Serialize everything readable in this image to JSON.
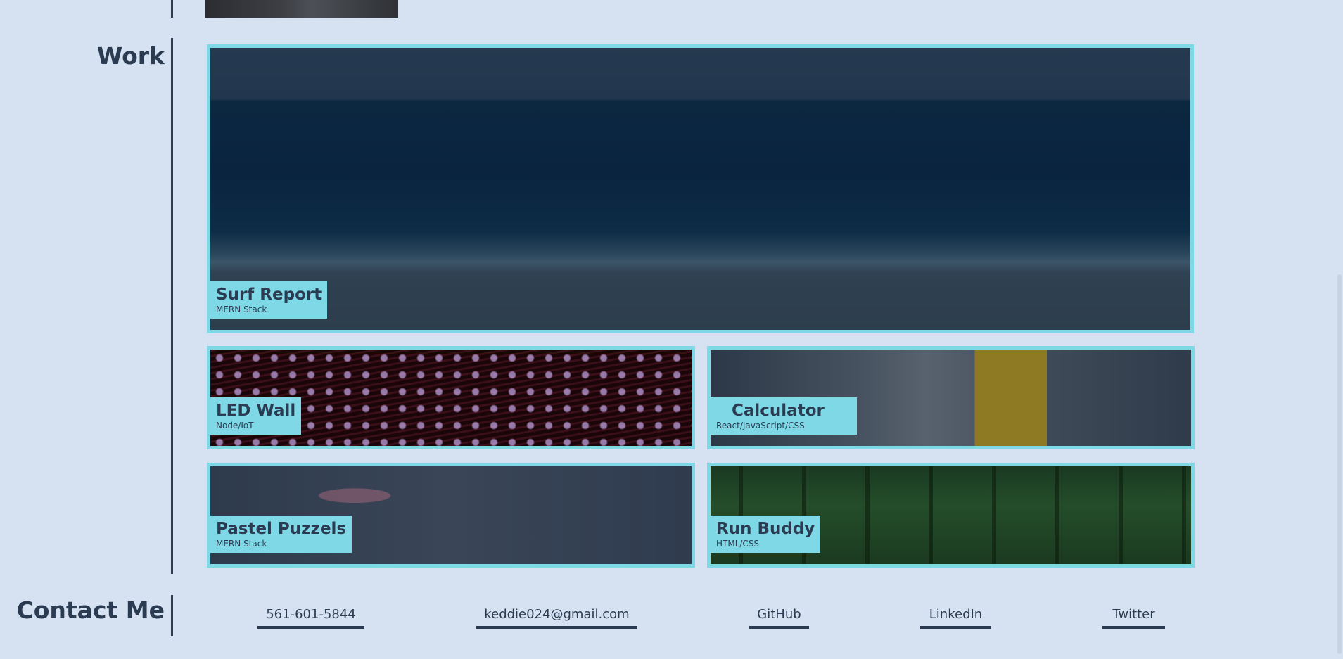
{
  "work": {
    "title": "Work",
    "projects": [
      {
        "name": "Surf Report",
        "tech": "MERN Stack"
      },
      {
        "name": "LED Wall",
        "tech": "Node/IoT"
      },
      {
        "name": "Calculator",
        "tech": "React/JavaScript/CSS"
      },
      {
        "name": "Pastel Puzzels",
        "tech": "MERN Stack"
      },
      {
        "name": "Run Buddy",
        "tech": "HTML/CSS"
      }
    ]
  },
  "contact": {
    "title": "Contact Me",
    "links": [
      {
        "label": "561-601-5844"
      },
      {
        "label": "keddie024@gmail.com"
      },
      {
        "label": "GitHub"
      },
      {
        "label": "LinkedIn"
      },
      {
        "label": "Twitter"
      }
    ]
  },
  "colors": {
    "background": "#d6e2f1",
    "accent": "#7fd8e6",
    "text": "#2b3c52"
  }
}
